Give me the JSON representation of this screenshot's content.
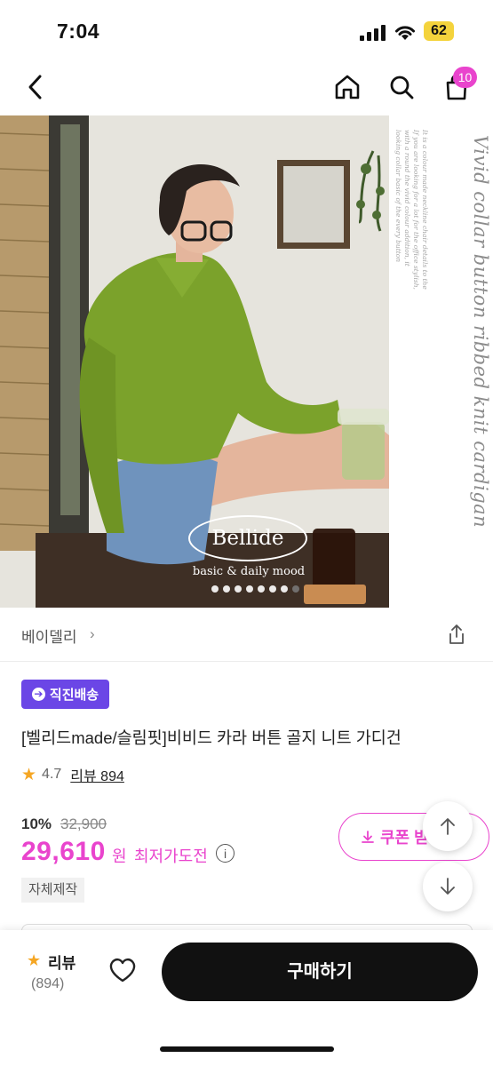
{
  "status_bar": {
    "time": "7:04",
    "battery": "62"
  },
  "header": {
    "cart_count": "10"
  },
  "hero": {
    "side_title": "Vivid collar button ribbed knit cardigan",
    "side_lines": [
      "It is a colour made neckline chair details to the",
      "If you are looking for a lot for the office stylish,",
      "with a round the vivid colour addition, it",
      "looking collar basic of the every button"
    ],
    "logo_text": "Bellide",
    "logo_sub": "basic & daily mood",
    "slide_count": 8,
    "active_slide": 8,
    "colors": {
      "cardigan": "#7a9e2a",
      "skirt": "#5b7fa8",
      "wall": "#e8e6df"
    }
  },
  "brand": {
    "name": "베이델리"
  },
  "badge": {
    "label": "직진배송",
    "color": "#6b46e6"
  },
  "product": {
    "name": "[벨리드made/슬림핏]비비드 카라 버튼 골지 니트 가디건",
    "rating": "4.7",
    "review_link": "리뷰 894"
  },
  "price": {
    "discount": "10%",
    "original": "32,900",
    "current": "29,610",
    "unit": "원",
    "lowest_label": "최저가도전",
    "info_icon": "ⓘ",
    "accent_color": "#e944cd"
  },
  "coupon": {
    "label": "쿠폰 받기"
  },
  "tag": {
    "label": "자체제작"
  },
  "bottom_bar": {
    "review_label": "리뷰",
    "review_count": "(894)",
    "buy_label": "구매하기"
  }
}
